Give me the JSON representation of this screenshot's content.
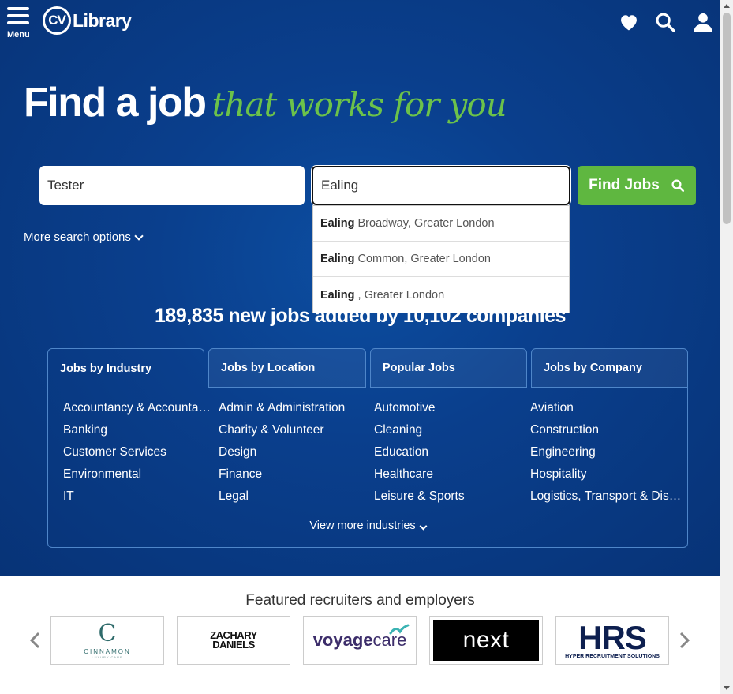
{
  "header": {
    "menu_label": "Menu",
    "logo_cv": "CV",
    "logo_text": "Library"
  },
  "hero": {
    "headline_main": "Find a job",
    "headline_script": "that works for you",
    "jobs_count": "189,835 new jobs added by 10,102 companies"
  },
  "search": {
    "keyword_value": "Tester",
    "location_value": "Ealing",
    "button_label": "Find Jobs",
    "more_options": "More search options",
    "suggestions": [
      {
        "match": "Ealing",
        "rest": " Broadway, Greater London"
      },
      {
        "match": "Ealing",
        "rest": " Common, Greater London"
      },
      {
        "match": "Ealing",
        "rest": ", Greater London"
      }
    ]
  },
  "tabs": [
    {
      "label": "Jobs by Industry"
    },
    {
      "label": "Jobs by Location"
    },
    {
      "label": "Popular Jobs"
    },
    {
      "label": "Jobs by Company"
    }
  ],
  "industries": [
    "Accountancy & Accountancy (Qualified)",
    "Admin & Administration",
    "Automotive",
    "Aviation",
    "Banking",
    "Charity & Volunteer",
    "Cleaning",
    "Construction",
    "Customer Services",
    "Design",
    "Education",
    "Engineering",
    "Environmental",
    "Finance",
    "Healthcare",
    "Hospitality",
    "IT",
    "Legal",
    "Leisure & Sports",
    "Logistics, Transport & Distribution"
  ],
  "view_more": "View more industries",
  "featured": {
    "title": "Featured recruiters and employers",
    "logos": [
      {
        "name": "CINNAMON",
        "sub": "LUXURY CARE",
        "mark": "C",
        "color": "#2f6b6b"
      },
      {
        "name": "ZACHARY",
        "sub": "DANIELS",
        "color": "#111111"
      },
      {
        "name": "voyage",
        "sub": "care",
        "color": "#3d2e6b",
        "accent": "#3bb3b3"
      },
      {
        "name": "next",
        "color": "#ffffff",
        "bg": "#000000"
      },
      {
        "name": "HRS",
        "sub": "HYPER RECRUITMENT SOLUTIONS",
        "color": "#0d1f4f"
      }
    ]
  },
  "colors": {
    "brand_blue": "#0a3f8d",
    "accent_green": "#5fb740",
    "script_green": "#6cc24a"
  }
}
